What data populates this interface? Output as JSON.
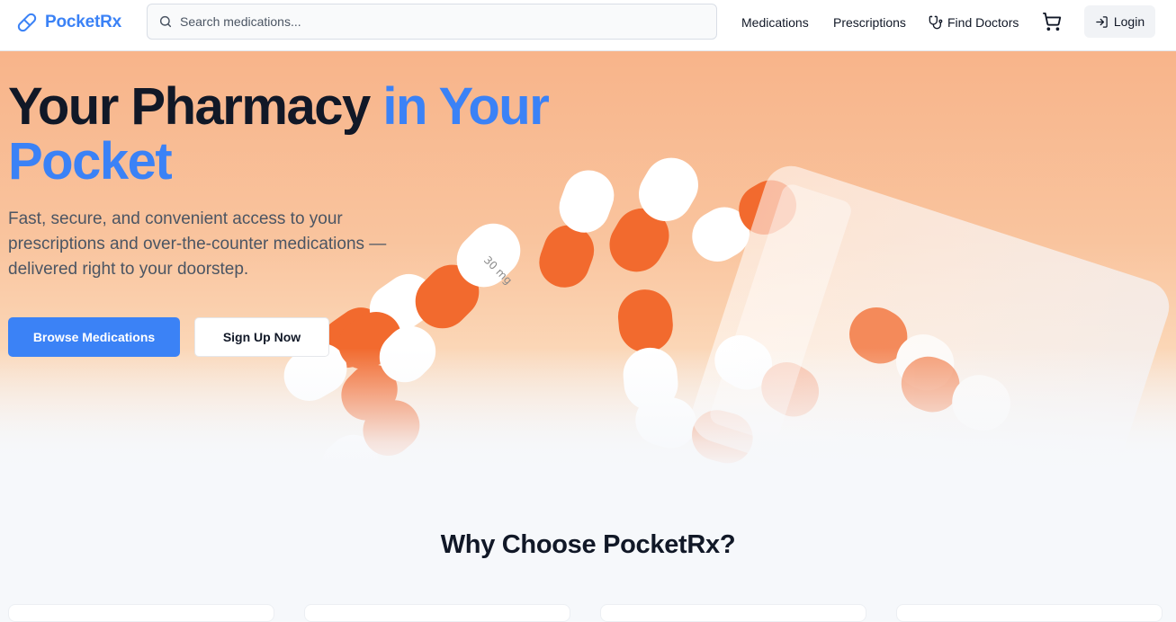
{
  "header": {
    "brand": "PocketRx",
    "search_placeholder": "Search medications...",
    "nav": {
      "medications": "Medications",
      "prescriptions": "Prescriptions",
      "find_doctors": "Find Doctors"
    },
    "login": "Login"
  },
  "hero": {
    "title_dark": "Your Pharmacy",
    "title_accent": "in Your Pocket",
    "subtitle": "Fast, secure, and convenient access to your prescriptions and over-the-counter medications — delivered right to your doorstep.",
    "primary_button": "Browse Medications",
    "secondary_button": "Sign Up Now",
    "image_description_icon": "orange-white-capsules-image"
  },
  "why": {
    "title": "Why Choose PocketRx?"
  },
  "colors": {
    "accent": "#3b82f6",
    "text_dark": "#111827",
    "text_muted": "#4b5563",
    "hero_orange": "#f8b48a",
    "capsule_orange": "#f26a2e"
  }
}
